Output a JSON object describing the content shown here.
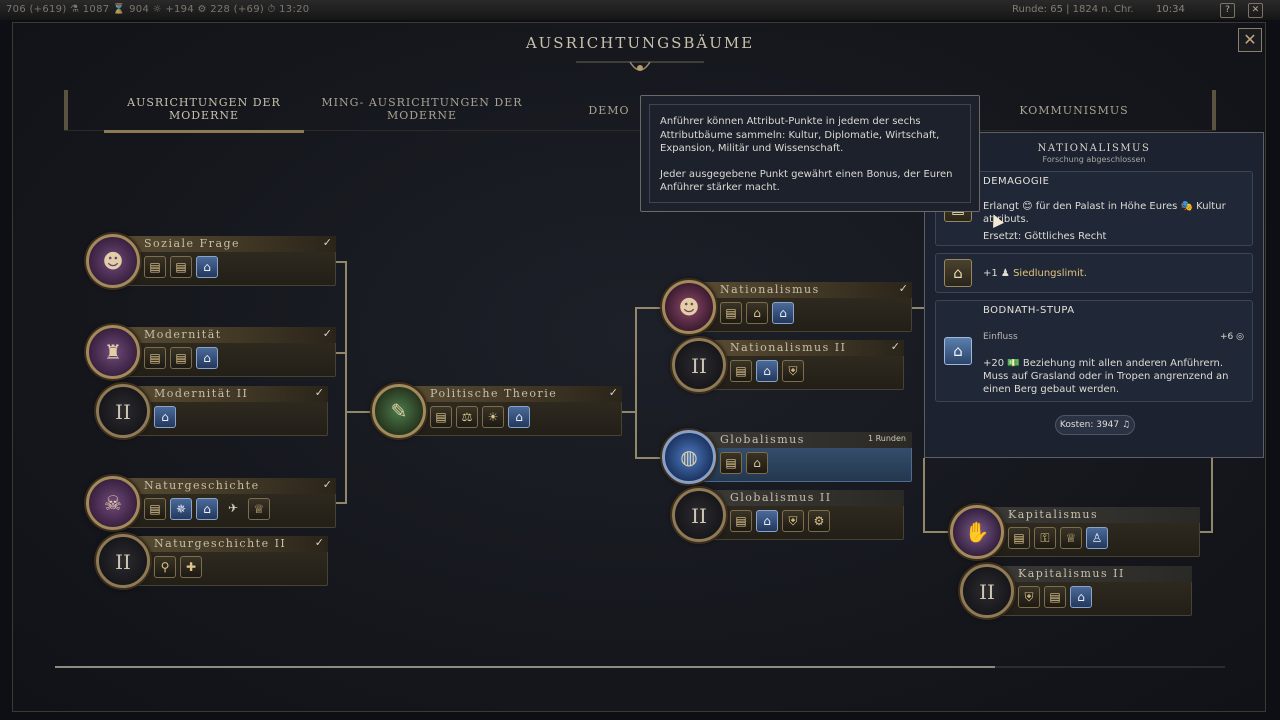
{
  "topbar": {
    "stats": "706 (+619)  ⚗ 1087  ⌛ 904  ☼ +194  ⚙ 228 (+69)  ⏱ 13:20",
    "right": "Runde: 65 | 1824 n. Chr.",
    "clock": "10:34",
    "icon_help": "?",
    "icon_close": "✕"
  },
  "window": {
    "title": "AUSRICHTUNGSBÄUME",
    "close_icon": "✕"
  },
  "tabs": [
    {
      "label": "AUSRICHTUNGEN DER MODERNE"
    },
    {
      "label": "MING- AUSRICHTUNGEN DER MODERNE"
    },
    {
      "label": "DEMO"
    },
    {
      "label": "KOMMUNISMUS"
    }
  ],
  "nodes": {
    "soziale_frage": {
      "label": "Soziale Frage",
      "check": "✓"
    },
    "modernitaet": {
      "label": "Modernität",
      "check": "✓"
    },
    "modernitaet2": {
      "label": "Modernität II",
      "check": "✓",
      "roman": "II"
    },
    "naturgeschichte": {
      "label": "Naturgeschichte",
      "check": "✓"
    },
    "naturgeschichte2": {
      "label": "Naturgeschichte II",
      "check": "✓",
      "roman": "II"
    },
    "politische_theorie": {
      "label": "Politische Theorie",
      "check": "✓"
    },
    "nationalismus": {
      "label": "Nationalismus",
      "check": "✓"
    },
    "nationalismus2": {
      "label": "Nationalismus II",
      "check": "✓",
      "roman": "II"
    },
    "globalismus": {
      "label": "Globalismus",
      "turns": "1 Runden"
    },
    "globalismus2": {
      "label": "Globalismus II",
      "roman": "II"
    },
    "kapitalismus": {
      "label": "Kapitalismus"
    },
    "kapitalismus2": {
      "label": "Kapitalismus II",
      "roman": "II"
    }
  },
  "tooltip": {
    "p1": "Anführer können Attribut-Punkte in jedem der sechs Attributbäume sammeln: Kultur, Diplomatie, Wirtschaft, Expansion, Militär und Wissenschaft.",
    "p2": "Jeder ausgegebene Punkt gewährt einen Bonus, der Euren Anführer stärker macht."
  },
  "detail_card": {
    "title": "NATIONALISMUS",
    "subtitle": "Forschung abgeschlossen",
    "demagogie": {
      "heading": "DEMAGOGIE",
      "line1": "Erlangt 😊 für den Palast in Höhe Eures 🎭 Kultur attributs.",
      "line2": "Ersetzt: Göttliches Recht"
    },
    "settlement": {
      "text_prefix": "+1 ♟",
      "text_highlight": "Siedlungslimit."
    },
    "wonder": {
      "heading": "BODNATH-STUPA",
      "stat_label": "Einfluss",
      "stat_value": "+6 ◎",
      "desc": "+20 💵 Beziehung mit allen anderen Anführern. Muss auf Grasland oder in Tropen angrenzend an einen Berg gebaut werden."
    },
    "cost": "Kosten: 3947 ♫"
  }
}
